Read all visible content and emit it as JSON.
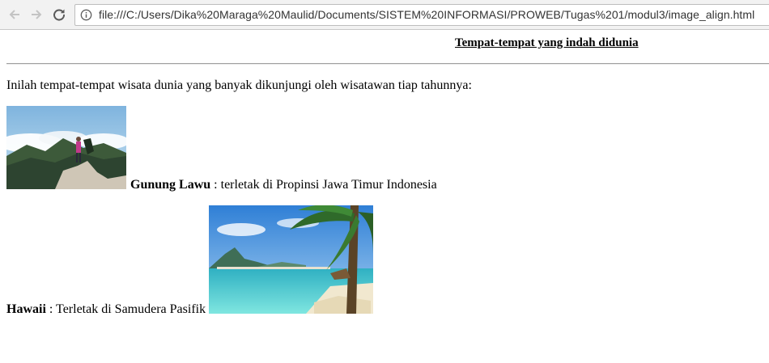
{
  "browser": {
    "url": "file:///C:/Users/Dika%20Maraga%20Maulid/Documents/SISTEM%20INFORMASI/PROWEB/Tugas%201/modul3/image_align.html"
  },
  "page": {
    "title": "Tempat-tempat yang indah didunia",
    "intro": "Inilah tempat-tempat wisata dunia yang banyak dikunjungi oleh wisatawan tiap tahunnya:",
    "places": [
      {
        "name": "Gunung Lawu",
        "description": " : terletak di Propinsi Jawa Timur Indonesia"
      },
      {
        "name": "Hawaii",
        "description": " : Terletak di Samudera Pasifik"
      }
    ]
  }
}
